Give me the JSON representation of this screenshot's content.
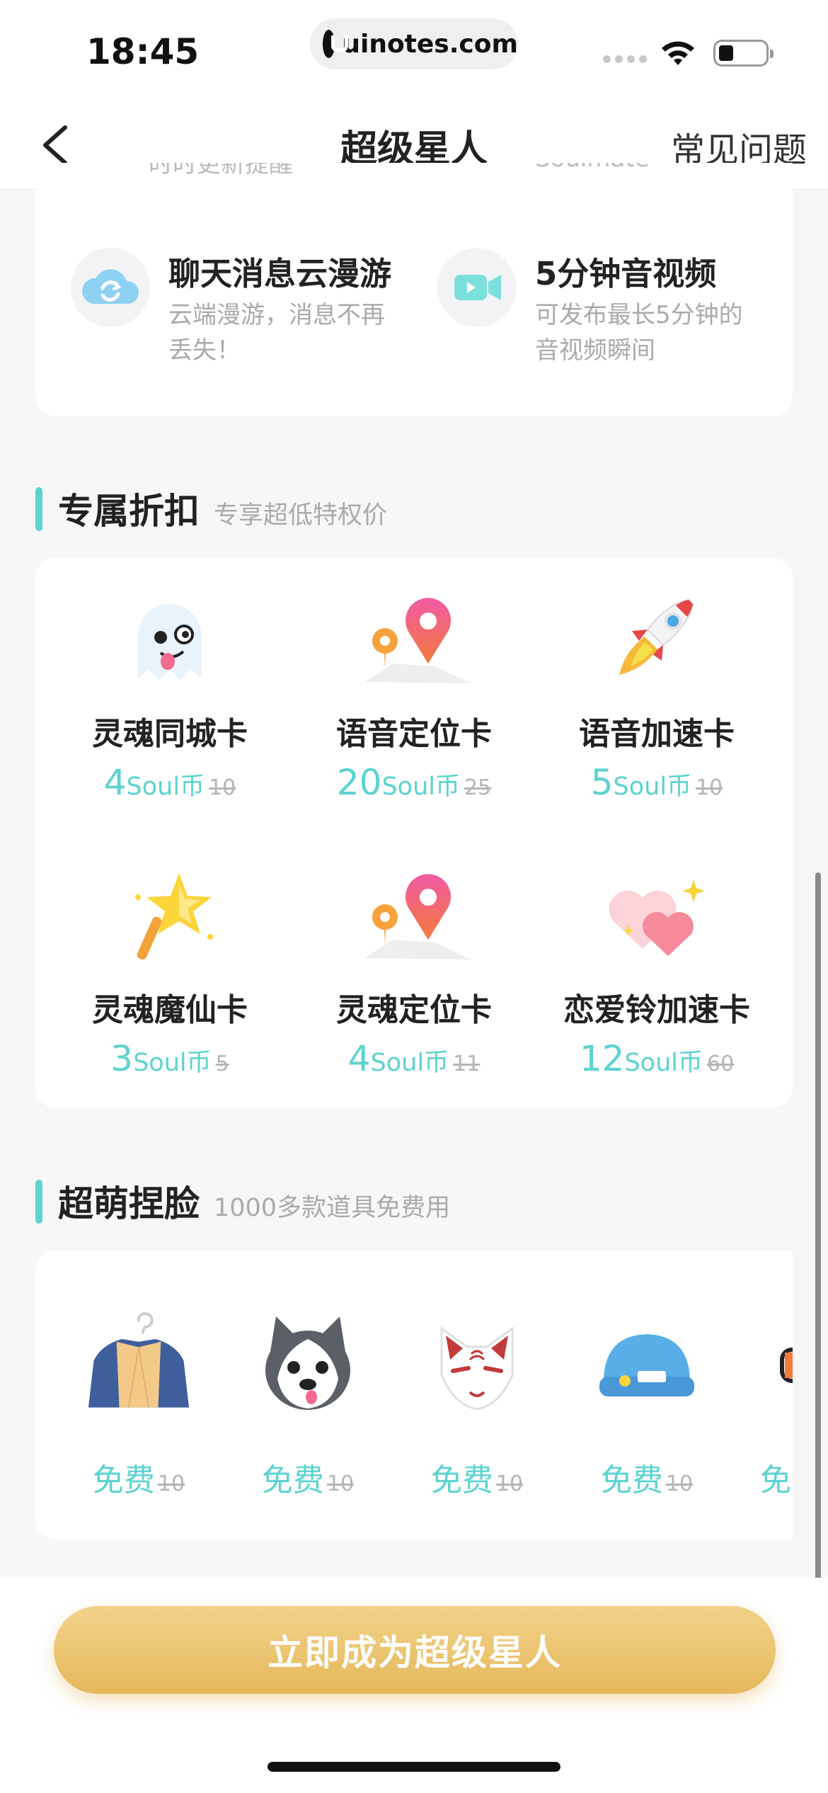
{
  "status_bar": {
    "time": "18:45",
    "url": "uinotes.com"
  },
  "nav": {
    "title": "超级星人",
    "faq": "常见问题"
  },
  "features": {
    "cut_left": "时时更新提醒",
    "cut_right": "Soulmate",
    "items": [
      {
        "title": "聊天消息云漫游",
        "desc": "云端漫游，消息不再丢失！",
        "icon": "cloud-sync-icon"
      },
      {
        "title": "5分钟音视频",
        "desc": "可发布最长5分钟的音视频瞬间",
        "icon": "video-camera-icon"
      }
    ]
  },
  "discount": {
    "title": "专属折扣",
    "subtitle": "专享超低特权价",
    "unit": "Soul币",
    "items": [
      {
        "name": "灵魂同城卡",
        "price": "4",
        "original": "10",
        "icon": "ghost-icon"
      },
      {
        "name": "语音定位卡",
        "price": "20",
        "original": "25",
        "icon": "location-pin-icon"
      },
      {
        "name": "语音加速卡",
        "price": "5",
        "original": "10",
        "icon": "rocket-icon"
      },
      {
        "name": "灵魂魔仙卡",
        "price": "3",
        "original": "5",
        "icon": "magic-wand-icon"
      },
      {
        "name": "灵魂定位卡",
        "price": "4",
        "original": "11",
        "icon": "location-pin-icon"
      },
      {
        "name": "恋爱铃加速卡",
        "price": "12",
        "original": "60",
        "icon": "hearts-icon"
      }
    ]
  },
  "faces": {
    "title": "超萌捏脸",
    "subtitle": "1000多款道具免费用",
    "free_label": "免费",
    "items": [
      {
        "original": "10",
        "icon": "jacket-icon"
      },
      {
        "original": "10",
        "icon": "husky-face-icon"
      },
      {
        "original": "10",
        "icon": "fox-mask-icon"
      },
      {
        "original": "10",
        "icon": "beanie-hat-icon"
      },
      {
        "original": "",
        "icon": "glasses-icon"
      }
    ],
    "partial_label": "免"
  },
  "cta": {
    "label": "立即成为超级星人"
  },
  "colors": {
    "accent": "#5cd3d0",
    "cta_gold": "#e9bf63"
  }
}
